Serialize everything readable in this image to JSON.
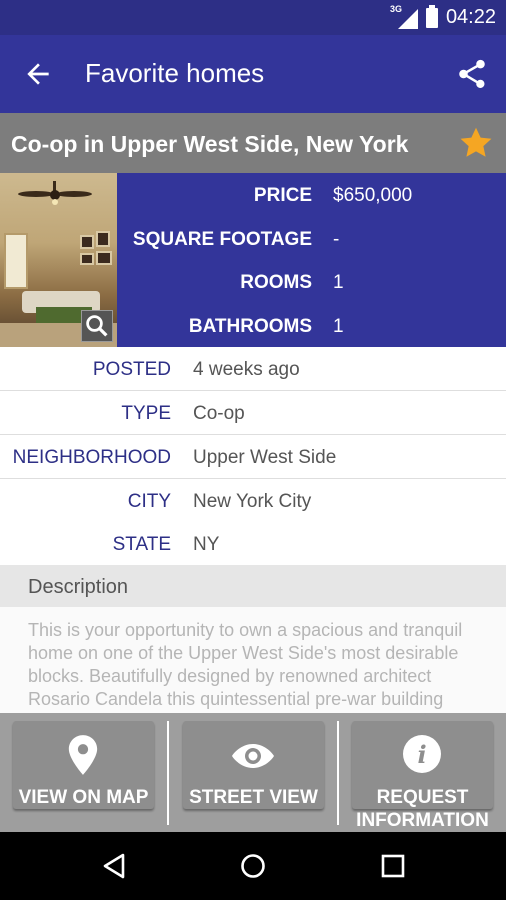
{
  "status_bar": {
    "network": "3G",
    "time": "04:22"
  },
  "app_bar": {
    "title": "Favorite homes"
  },
  "listing": {
    "title": "Co-op in Upper West Side, New York",
    "favorite": true,
    "specs": [
      {
        "label": "PRICE",
        "value": "$650,000"
      },
      {
        "label": "SQUARE FOOTAGE",
        "value": "-"
      },
      {
        "label": "ROOMS",
        "value": "1"
      },
      {
        "label": "BATHROOMS",
        "value": "1"
      }
    ],
    "details": [
      {
        "label": "POSTED",
        "value": "4 weeks ago"
      },
      {
        "label": "TYPE",
        "value": "Co-op"
      },
      {
        "label": "NEIGHBORHOOD",
        "value": "Upper West Side"
      },
      {
        "label": "CITY",
        "value": "New York City"
      },
      {
        "label": "STATE",
        "value": "NY"
      }
    ],
    "description_header": "Description",
    "description": "This is your opportunity to own a spacious and tranquil home on one of the Upper West Side's most desirable blocks. Beautifully designed by renowned architect Rosario Candela this quintessential pre-war building features classic architectural details"
  },
  "actions": {
    "map": "VIEW ON MAP",
    "street": "STREET VIEW",
    "request_line1": "REQUEST",
    "request_line2": "INFORMATION"
  },
  "colors": {
    "primary": "#33359a",
    "primary_dark": "#2d2f86",
    "title_bar": "#7d7d7d",
    "star": "#f5a623",
    "label_blue": "#2d2f86"
  },
  "icons": [
    "back-arrow-icon",
    "share-icon",
    "star-icon",
    "zoom-icon",
    "map-pin-icon",
    "eye-icon",
    "info-icon",
    "nav-back-icon",
    "nav-home-icon",
    "nav-recents-icon"
  ]
}
